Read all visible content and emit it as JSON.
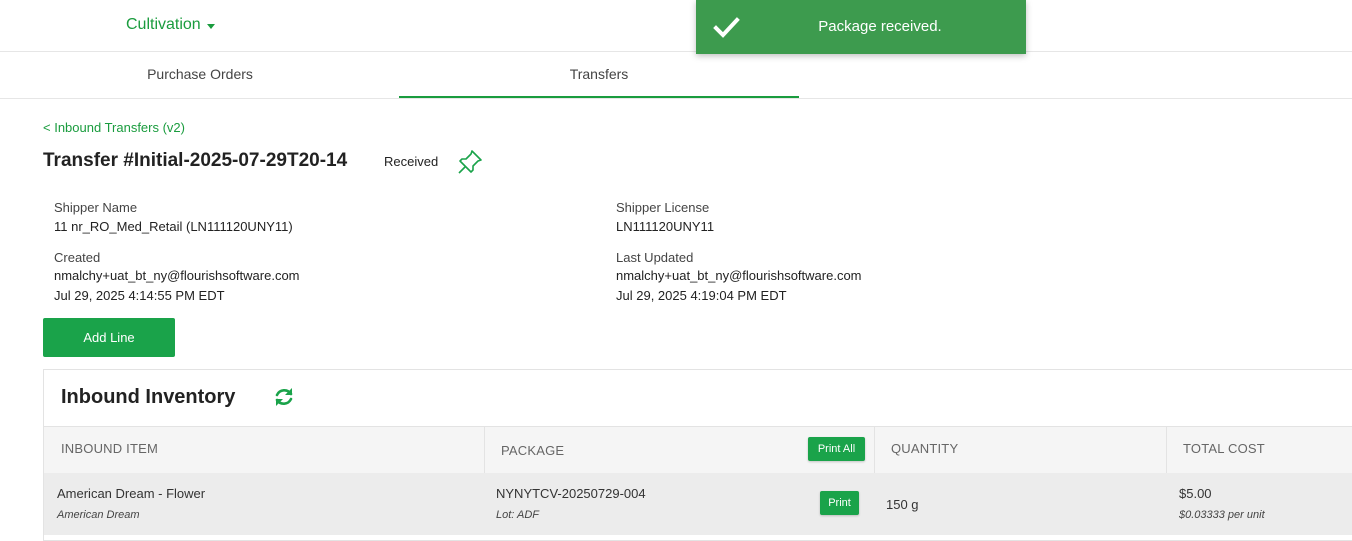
{
  "header": {
    "app_menu_label": "Cultivation"
  },
  "toast": {
    "message": "Package received."
  },
  "tabs": [
    {
      "label": "Purchase Orders",
      "active": false
    },
    {
      "label": "Transfers",
      "active": true
    }
  ],
  "breadcrumb": {
    "back_label": "< Inbound Transfers (v2)"
  },
  "transfer": {
    "title": "Transfer #Initial-2025-07-29T20-14",
    "status": "Received",
    "shipper_name_label": "Shipper Name",
    "shipper_name": "11 nr_RO_Med_Retail (LN111120UNY11)",
    "shipper_license_label": "Shipper License",
    "shipper_license": "LN111120UNY11",
    "created_label": "Created",
    "created_by": "nmalchy+uat_bt_ny@flourishsoftware.com",
    "created_at": "Jul 29, 2025 4:14:55 PM EDT",
    "updated_label": "Last Updated",
    "updated_by": "nmalchy+uat_bt_ny@flourishsoftware.com",
    "updated_at": "Jul 29, 2025 4:19:04 PM EDT"
  },
  "actions": {
    "add_line_label": "Add Line"
  },
  "inventory": {
    "title": "Inbound Inventory",
    "columns": {
      "item": "INBOUND ITEM",
      "package": "PACKAGE",
      "quantity": "QUANTITY",
      "total_cost": "TOTAL COST"
    },
    "print_all_label": "Print All",
    "rows": [
      {
        "item_name": "American Dream - Flower",
        "item_strain": "American Dream",
        "package_id": "NYNYTCV-20250729-004",
        "lot": "Lot: ADF",
        "print_label": "Print",
        "quantity": "150 g",
        "total_cost": "$5.00",
        "unit_cost": "$0.03333 per unit"
      }
    ]
  },
  "colors": {
    "accent": "#1aa34a",
    "toast_bg": "#3d9b4e",
    "row_bg": "#ececec"
  }
}
